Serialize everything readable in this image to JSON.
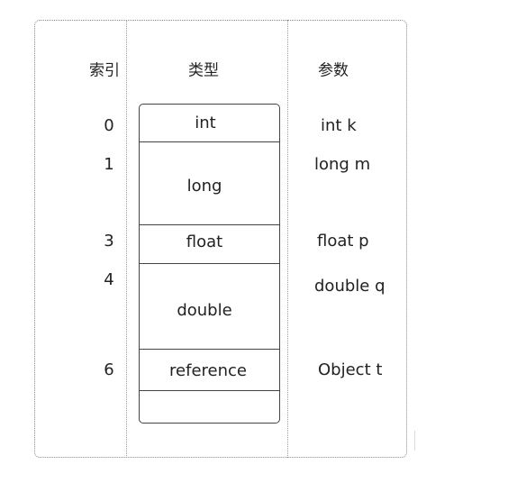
{
  "headers": {
    "index": "索引",
    "type": "类型",
    "param": "参数"
  },
  "rows": [
    {
      "index": "0",
      "type": "int",
      "param": "int k"
    },
    {
      "index": "1",
      "type": "long",
      "param": "long m"
    },
    {
      "index": "3",
      "type": "float",
      "param": "float p"
    },
    {
      "index": "4",
      "type": "double",
      "param": "double q"
    },
    {
      "index": "6",
      "type": "reference",
      "param": "Object t"
    }
  ]
}
